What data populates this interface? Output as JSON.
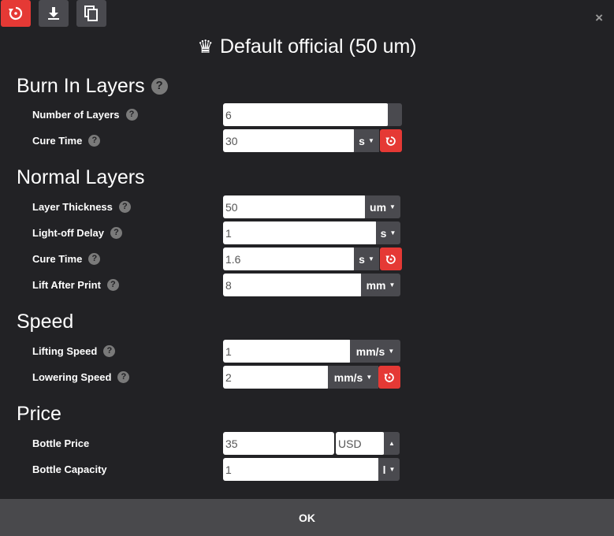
{
  "toolbar": {
    "reset_icon": "reset-icon",
    "download_icon": "download-icon",
    "copy_icon": "copy-icon"
  },
  "close_label": "×",
  "title": {
    "crown": "♛",
    "text": "Default official (50 um)"
  },
  "help_glyph": "?",
  "sections": {
    "burn_in": "Burn In Layers",
    "normal": "Normal Layers",
    "speed": "Speed",
    "price": "Price"
  },
  "fields": {
    "burn_layers": {
      "label": "Number of Layers",
      "value": "6"
    },
    "burn_cure": {
      "label": "Cure Time",
      "value": "30",
      "unit": "s"
    },
    "layer_thickness": {
      "label": "Layer Thickness",
      "value": "50",
      "unit": "um"
    },
    "light_off": {
      "label": "Light-off Delay",
      "value": "1",
      "unit": "s"
    },
    "normal_cure": {
      "label": "Cure Time",
      "value": "1.6",
      "unit": "s"
    },
    "lift": {
      "label": "Lift After Print",
      "value": "8",
      "unit": "mm"
    },
    "lifting_speed": {
      "label": "Lifting Speed",
      "value": "1",
      "unit": "mm/s"
    },
    "lowering_speed": {
      "label": "Lowering Speed",
      "value": "2",
      "unit": "mm/s"
    },
    "bottle_price": {
      "label": "Bottle Price",
      "value": "35",
      "currency": "USD"
    },
    "bottle_capacity": {
      "label": "Bottle Capacity",
      "value": "1",
      "unit": "l"
    }
  },
  "ok_label": "OK",
  "colors": {
    "accent_red": "#e53935",
    "background": "#222225",
    "unit_gray": "#4a4a4f"
  }
}
